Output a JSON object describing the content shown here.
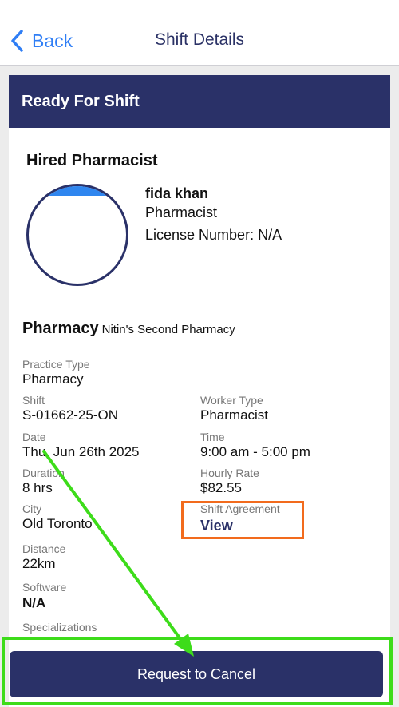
{
  "nav": {
    "back_label": "Back",
    "title": "Shift Details"
  },
  "banner": {
    "title": "Ready For Shift"
  },
  "hired": {
    "section_title": "Hired Pharmacist",
    "name": "fida khan",
    "role": "Pharmacist",
    "license": "License Number: N/A"
  },
  "pharmacy": {
    "label": "Pharmacy",
    "name": "Nitin's Second Pharmacy"
  },
  "details": {
    "practice_type": {
      "label": "Practice Type",
      "value": "Pharmacy"
    },
    "shift": {
      "label": "Shift",
      "value": "S-01662-25-ON"
    },
    "worker_type": {
      "label": "Worker Type",
      "value": "Pharmacist"
    },
    "date": {
      "label": "Date",
      "value": "Thu, Jun 26th 2025"
    },
    "time": {
      "label": "Time",
      "value": "9:00 am - 5:00 pm"
    },
    "duration": {
      "label": "Duration",
      "value": "8 hrs"
    },
    "hourly_rate": {
      "label": "Hourly Rate",
      "value": "$82.55"
    },
    "city": {
      "label": "City",
      "value": "Old Toronto"
    },
    "shift_agreement": {
      "label": "Shift Agreement",
      "link": "View"
    },
    "distance": {
      "label": "Distance",
      "value": "22km"
    },
    "software": {
      "label": "Software",
      "value": "N/A"
    },
    "specializations": {
      "label": "Specializations"
    }
  },
  "footer": {
    "cancel_label": "Request to Cancel"
  },
  "colors": {
    "primary": "#2a3168",
    "link": "#2f7ef5",
    "annotation_orange": "#f26b1d",
    "annotation_green": "#3ddc1a"
  }
}
